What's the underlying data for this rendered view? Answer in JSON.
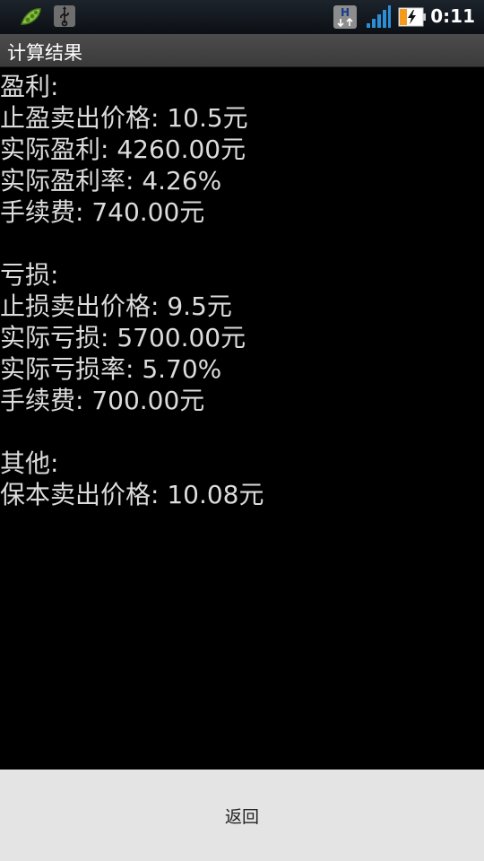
{
  "status_bar": {
    "time": "0:11",
    "icons": [
      "pea-app-icon",
      "usb-icon",
      "hsdpa-icon",
      "signal-icon",
      "battery-charging-icon"
    ],
    "hsdpa_letter": "H"
  },
  "title": "计算结果",
  "profit": {
    "heading": "盈利:",
    "take_profit_price": "止盈卖出价格: 10.5元",
    "actual_profit": "实际盈利: 4260.00元",
    "actual_profit_rate": "实际盈利率: 4.26%",
    "fee": "手续费: 740.00元"
  },
  "loss": {
    "heading": "亏损:",
    "stop_loss_price": "止损卖出价格: 9.5元",
    "actual_loss": "实际亏损: 5700.00元",
    "actual_loss_rate": "实际亏损率: 5.70%",
    "fee": "手续费: 700.00元"
  },
  "other": {
    "heading": "其他:",
    "breakeven_price": "保本卖出价格: 10.08元"
  },
  "back_button_label": "返回",
  "colors": {
    "background": "#000000",
    "text": "#dcdcdc",
    "title_bar": "#444444",
    "bottom_bar": "#e4e4e4",
    "battery_accent": "#f59a1c",
    "signal": "#2c8fd6"
  }
}
